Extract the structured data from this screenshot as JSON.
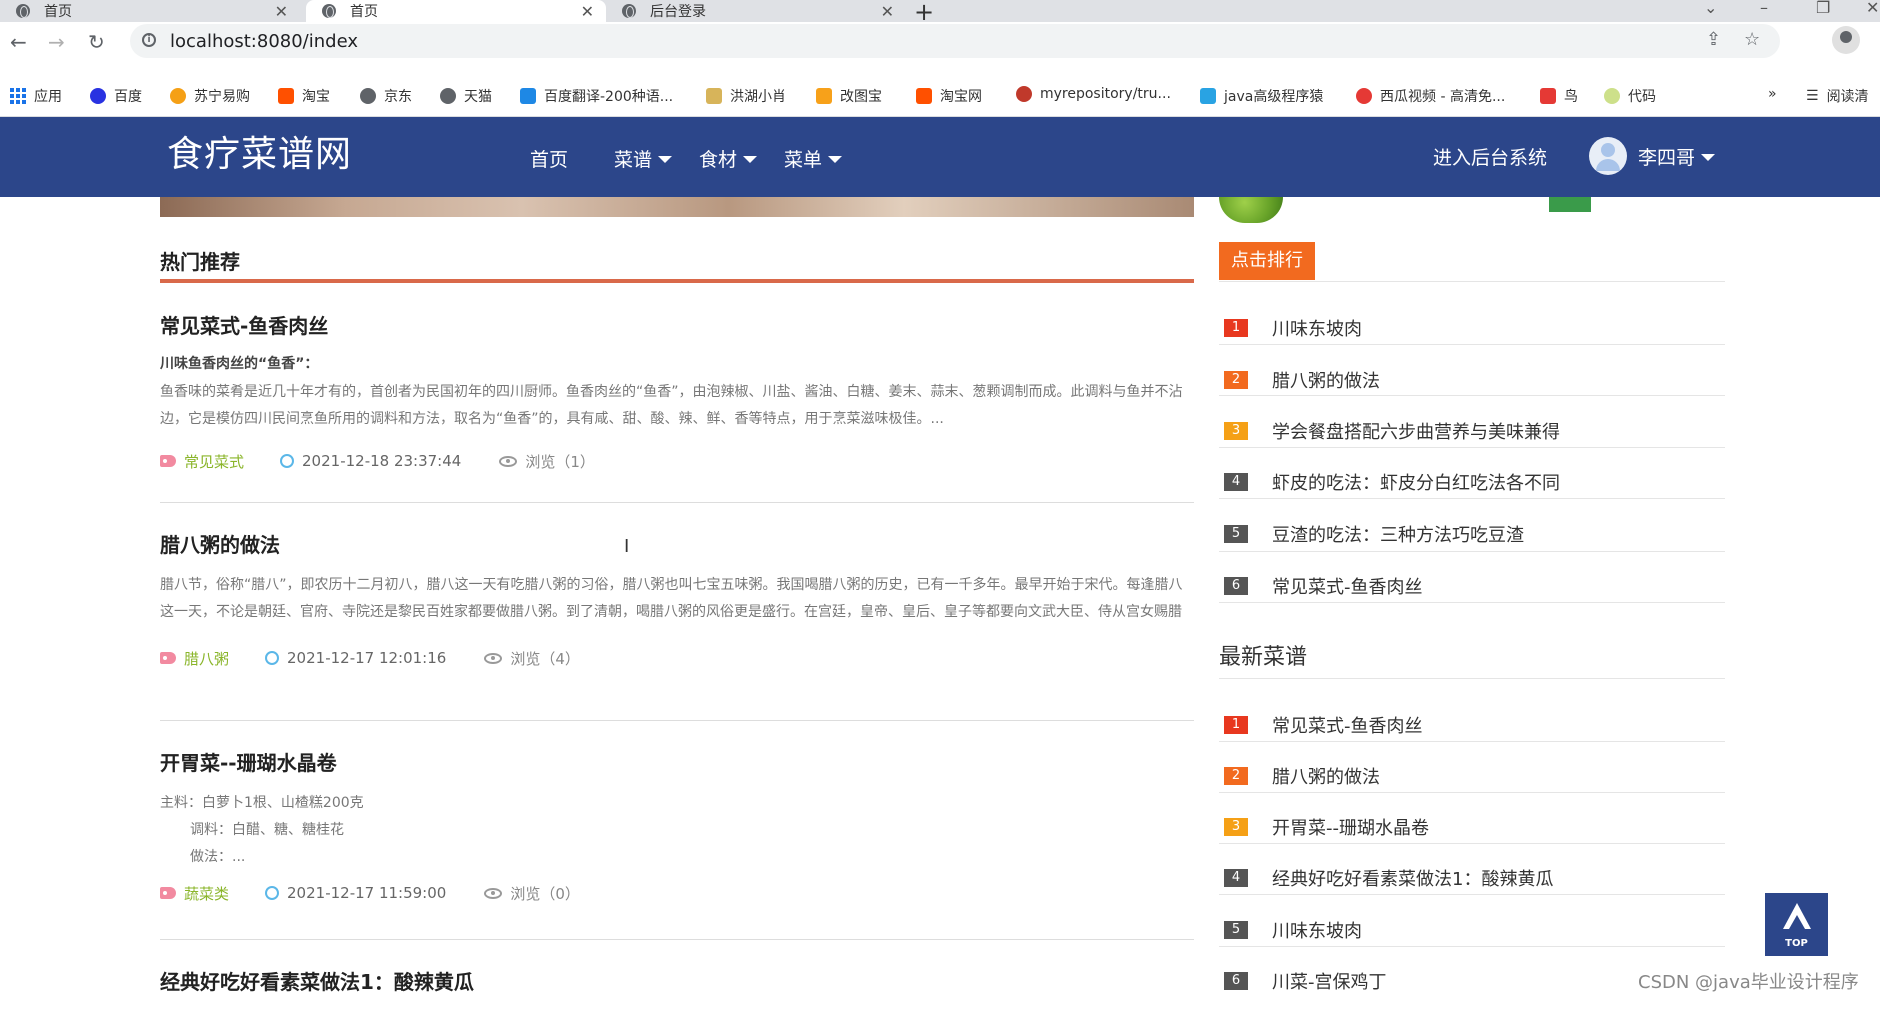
{
  "browser": {
    "tabs": [
      {
        "title": "首页"
      },
      {
        "title": "首页"
      },
      {
        "title": "后台登录"
      }
    ],
    "url": "localhost:8080/index",
    "bookmarks": [
      {
        "label": "应用"
      },
      {
        "label": "百度"
      },
      {
        "label": "苏宁易购"
      },
      {
        "label": "淘宝"
      },
      {
        "label": "京东"
      },
      {
        "label": "天猫"
      },
      {
        "label": "百度翻译-200种语..."
      },
      {
        "label": "洪湖小肖"
      },
      {
        "label": "改图宝"
      },
      {
        "label": "淘宝网"
      },
      {
        "label": "myrepository/tru..."
      },
      {
        "label": "java高级程序猿"
      },
      {
        "label": "西瓜视频 - 高清免..."
      },
      {
        "label": "鸟"
      },
      {
        "label": "代码"
      }
    ],
    "more_bookmarks": "»",
    "reading_list": "阅读清"
  },
  "header": {
    "logo": "食疗菜谱网",
    "nav": [
      {
        "label": "首页"
      },
      {
        "label": "菜谱"
      },
      {
        "label": "食材"
      },
      {
        "label": "菜单"
      }
    ],
    "admin_link": "进入后台系统",
    "user_name": "李四哥"
  },
  "main": {
    "section_title": "热门推荐",
    "articles": [
      {
        "title": "常见菜式-鱼香肉丝",
        "lead": "川味鱼香肉丝的“鱼香”：",
        "body": "鱼香味的菜肴是近几十年才有的，首创者为民国初年的四川厨师。鱼香肉丝的“鱼香”，由泡辣椒、川盐、酱油、白糖、姜末、蒜末、葱颗调制而成。此调料与鱼并不沾边，它是模仿四川民间烹鱼所用的调料和方法，取名为“鱼香”的，具有咸、甜、酸、辣、鲜、香等特点，用于烹菜滋味极佳。...",
        "tag": "常见菜式",
        "date": "2021-12-18 23:37:44",
        "views": "浏览（1）"
      },
      {
        "title": "腊八粥的做法",
        "body": "腊八节，俗称“腊八”，即农历十二月初八，腊八这一天有吃腊八粥的习俗，腊八粥也叫七宝五味粥。我国喝腊八粥的历史，已有一千多年。最早开始于宋代。每逢腊八这一天，不论是朝廷、官府、寺院还是黎民百姓家都要做腊八粥。到了清朝，喝腊八粥的风俗更是盛行。在宫廷，皇帝、皇后、皇子等都要向文武大臣、侍从宫女赐腊八粥，并向各个寺院发放米、果等供僧侣食用。在民间，家家户户也要做腊八粥，祭祀祖先;同时，合家团聚在一起食用，馈赠亲...",
        "tag": "腊八粥",
        "date": "2021-12-17 12:01:16",
        "views": "浏览（4）"
      },
      {
        "title": "开胃菜--珊瑚水晶卷",
        "body_lines": [
          "主料：白萝卜1根、山楂糕200克",
          "调料：白醋、糖、糖桂花",
          "做法：..."
        ],
        "tag": "蔬菜类",
        "date": "2021-12-17 11:59:00",
        "views": "浏览（0）"
      },
      {
        "title": "经典好吃好看素菜做法1：酸辣黄瓜"
      }
    ]
  },
  "sidebar": {
    "rank_button": "点击排行",
    "rank_list": [
      {
        "num": "1",
        "title": "川味东坡肉"
      },
      {
        "num": "2",
        "title": "腊八粥的做法"
      },
      {
        "num": "3",
        "title": "学会餐盘搭配六步曲营养与美味兼得"
      },
      {
        "num": "4",
        "title": "虾皮的吃法：虾皮分白红吃法各不同"
      },
      {
        "num": "5",
        "title": "豆渣的吃法：三种方法巧吃豆渣"
      },
      {
        "num": "6",
        "title": "常见菜式-鱼香肉丝"
      }
    ],
    "latest_title": "最新菜谱",
    "latest_list": [
      {
        "num": "1",
        "title": "常见菜式-鱼香肉丝"
      },
      {
        "num": "2",
        "title": "腊八粥的做法"
      },
      {
        "num": "3",
        "title": "开胃菜--珊瑚水晶卷"
      },
      {
        "num": "4",
        "title": "经典好吃好看素菜做法1：酸辣黄瓜"
      },
      {
        "num": "5",
        "title": "川味东坡肉"
      },
      {
        "num": "6",
        "title": "川菜-宫保鸡丁"
      }
    ]
  },
  "top_button": "TOP",
  "watermark": "CSDN @java毕业设计程序"
}
